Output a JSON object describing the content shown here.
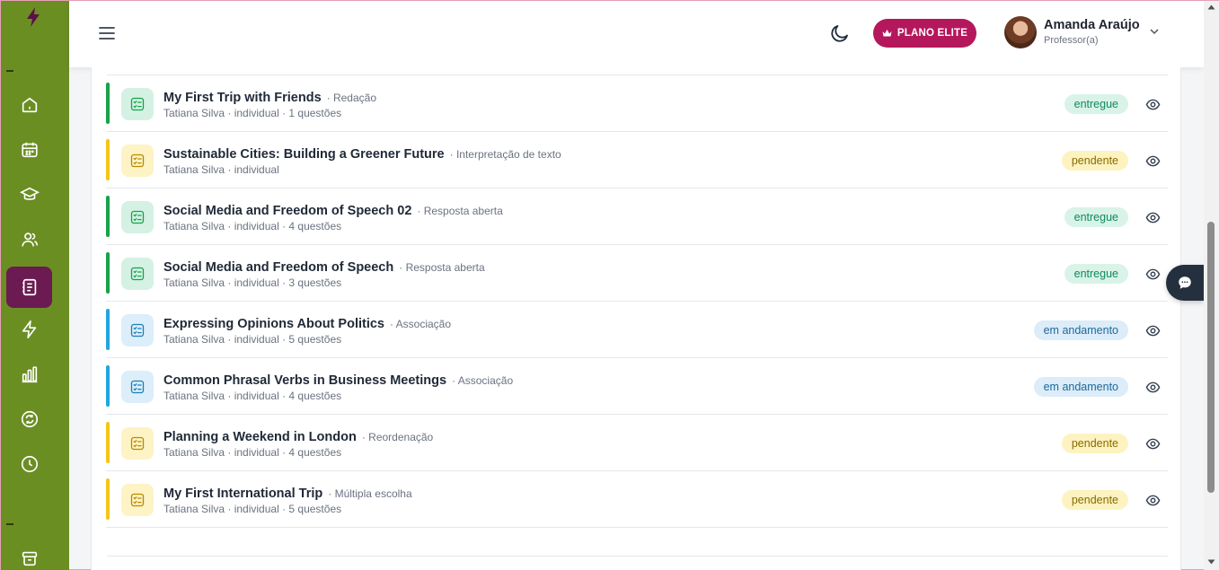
{
  "sidebar": {
    "items": [
      {
        "icon": "home-icon"
      },
      {
        "icon": "calendar-icon"
      },
      {
        "icon": "graduation-cap-icon"
      },
      {
        "icon": "users-icon"
      },
      {
        "icon": "notebook-icon",
        "active": true
      },
      {
        "icon": "lightning-icon"
      },
      {
        "icon": "bar-chart-icon"
      },
      {
        "icon": "refresh-icon"
      },
      {
        "icon": "clock-icon"
      },
      {
        "icon": "box-icon"
      }
    ]
  },
  "header": {
    "plan_label": "PLANO ELITE",
    "user": {
      "name": "Amanda Araújo",
      "role": "Professor(a)"
    }
  },
  "colors": {
    "sidebar": "#6b8e23",
    "active": "#6b1a52",
    "brand": "#b5175c",
    "green": "#16a34a",
    "yellow": "#f5c518",
    "blue": "#22a6e0"
  },
  "activities": [
    {
      "title": "My First Trip with Friends",
      "type": "· Redação",
      "meta": "Tatiana Silva · individual · 1 questões",
      "status": "entregue",
      "status_kind": "entregue",
      "color": "green"
    },
    {
      "title": "Sustainable Cities: Building a Greener Future",
      "type": "· Interpretação de texto",
      "meta": "Tatiana Silva · individual",
      "status": "pendente",
      "status_kind": "pendente",
      "color": "yellow"
    },
    {
      "title": "Social Media and Freedom of Speech 02",
      "type": "· Resposta aberta",
      "meta": "Tatiana Silva · individual · 4 questões",
      "status": "entregue",
      "status_kind": "entregue",
      "color": "green"
    },
    {
      "title": "Social Media and Freedom of Speech",
      "type": "· Resposta aberta",
      "meta": "Tatiana Silva · individual · 3 questões",
      "status": "entregue",
      "status_kind": "entregue",
      "color": "green"
    },
    {
      "title": "Expressing Opinions About Politics",
      "type": "· Associação",
      "meta": "Tatiana Silva · individual · 5 questões",
      "status": "em andamento",
      "status_kind": "andamento",
      "color": "blue"
    },
    {
      "title": "Common Phrasal Verbs in Business Meetings",
      "type": "· Associação",
      "meta": "Tatiana Silva · individual · 4 questões",
      "status": "em andamento",
      "status_kind": "andamento",
      "color": "blue"
    },
    {
      "title": "Planning a Weekend in London",
      "type": "· Reordenação",
      "meta": "Tatiana Silva · individual · 4 questões",
      "status": "pendente",
      "status_kind": "pendente",
      "color": "yellow"
    },
    {
      "title": "My First International Trip",
      "type": "· Múltipla escolha",
      "meta": "Tatiana Silva · individual · 5 questões",
      "status": "pendente",
      "status_kind": "pendente",
      "color": "yellow"
    }
  ]
}
